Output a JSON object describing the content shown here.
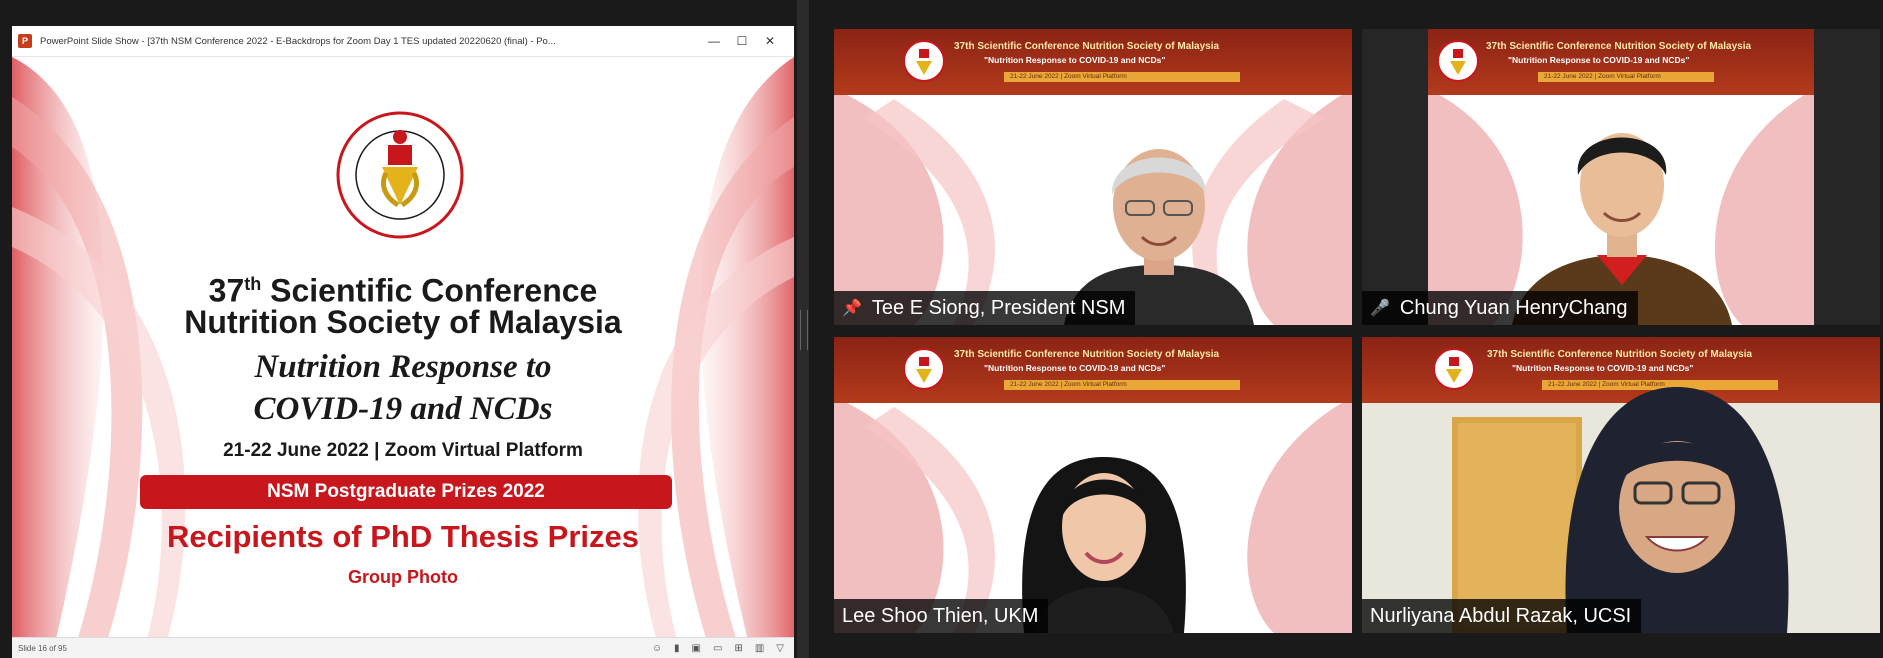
{
  "ppt": {
    "window_title": "PowerPoint Slide Show - [37th NSM Conference 2022 - E-Backdrops for Zoom Day 1 TES updated 20220620 (final) - Po...",
    "app_icon": "P",
    "controls": {
      "minimize": "—",
      "maximize": "☐",
      "close": "✕"
    },
    "slide": {
      "conf_prefix": "37",
      "conf_sup": "th",
      "conf_suffix": " Scientific Conference",
      "society": "Nutrition Society of Malaysia",
      "theme_line1": "Nutrition Response to",
      "theme_line2": "COVID-19 and NCDs",
      "date_platform": "21-22 June 2022 | Zoom Virtual Platform",
      "prize_bar": "NSM Postgraduate Prizes 2022",
      "recipients": "Recipients of PhD Thesis Prizes",
      "group_photo": "Group Photo"
    },
    "status": {
      "slide_count": "Slide 16 of 95"
    }
  },
  "zoom": {
    "banner": {
      "title": "37th Scientific Conference Nutrition Society of Malaysia",
      "subtitle": "\"Nutrition Response to COVID-19 and NCDs\"",
      "date": "21-22 June 2022 | Zoom Virtual Platform"
    },
    "tiles": [
      {
        "name": "Tee E Siong, President NSM",
        "icon": "pin-icon",
        "glyph": "📌"
      },
      {
        "name": "Chung Yuan HenryChang",
        "icon": "mic-muted-icon",
        "glyph": "🎤"
      },
      {
        "name": "Lee Shoo Thien, UKM",
        "icon": "",
        "glyph": ""
      },
      {
        "name": "Nurliyana Abdul Razak, UCSI",
        "icon": "",
        "glyph": ""
      }
    ]
  }
}
